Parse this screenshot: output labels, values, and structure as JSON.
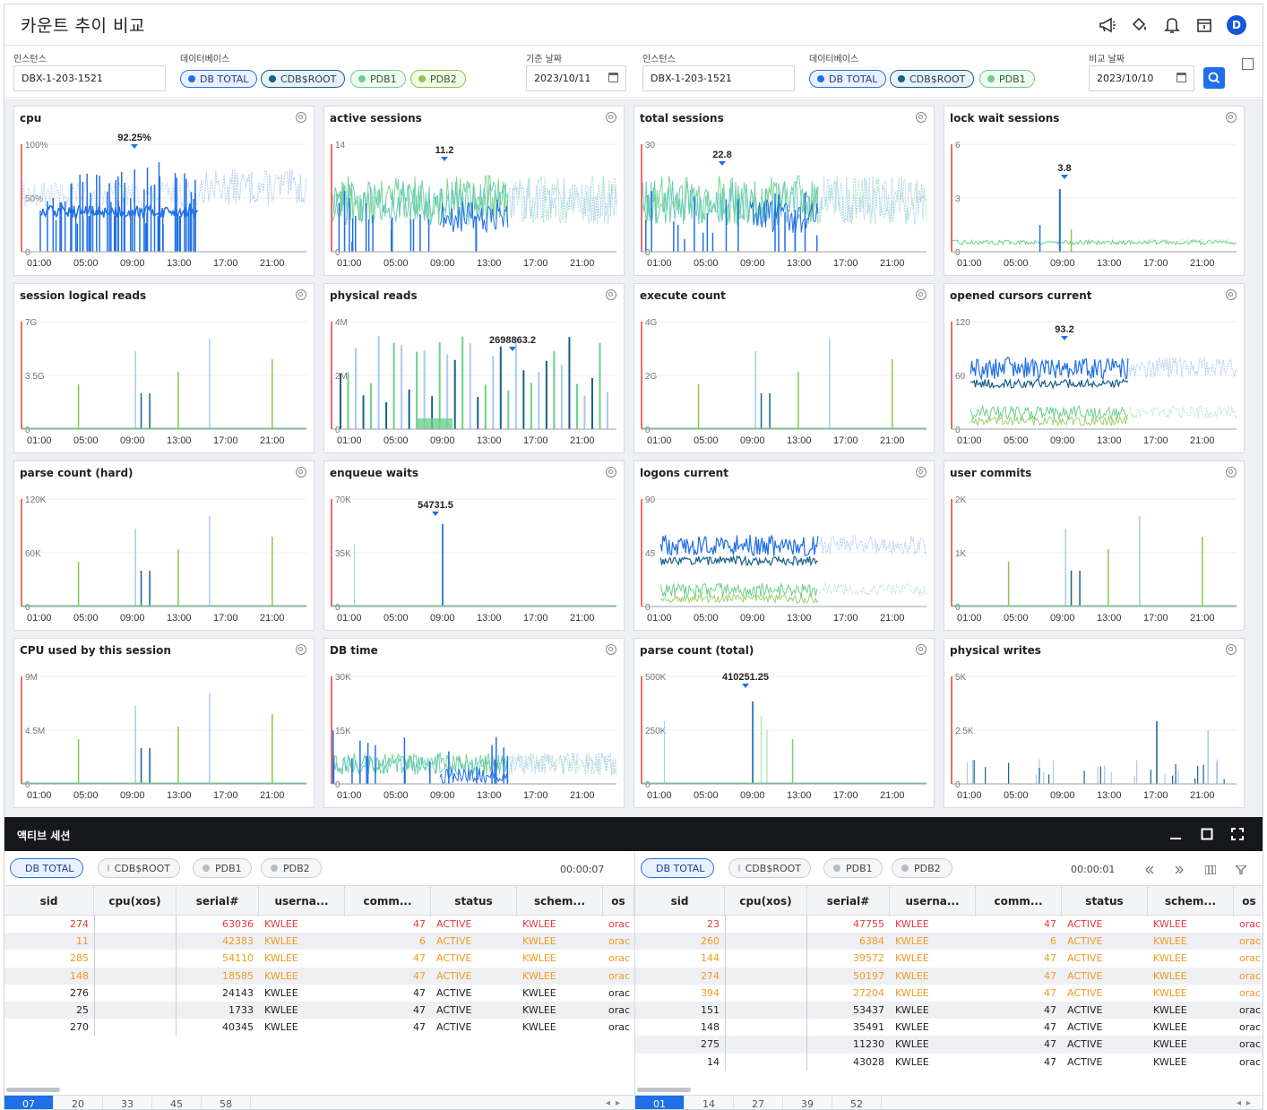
{
  "app": {
    "title": "카운트 추이 비교"
  },
  "header_icons": [
    "megaphone-icon",
    "paint-bucket-icon",
    "bell-icon",
    "calendar-icon"
  ],
  "user": {
    "initial": "D"
  },
  "filters": {
    "left": {
      "instance_label": "인스턴스",
      "instance_value": "DBX-1-203-1521",
      "db_label": "데이터베이스",
      "chips": [
        "DB TOTAL",
        "CDB$ROOT",
        "PDB1",
        "PDB2"
      ],
      "date_label": "기준 날짜",
      "date_value": "2023/10/11"
    },
    "right": {
      "instance_label": "인스턴스",
      "instance_value": "DBX-1-203-1521",
      "db_label": "데이터베이스",
      "chips": [
        "DB TOTAL",
        "CDB$ROOT",
        "PDB1"
      ],
      "date_label": "비교 날짜",
      "date_value": "2023/10/10"
    }
  },
  "colors": {
    "db_total": "#1f6fe8",
    "cdb_root": "#17608b",
    "pdb1": "#6dd08a",
    "pdb2": "#8ac64b",
    "compare_light": "#a9c9f2",
    "marker": "#f06b6b"
  },
  "x_ticks": [
    "01:00",
    "05:00",
    "09:00",
    "13:00",
    "17:00",
    "21:00"
  ],
  "charts": [
    {
      "title": "cpu",
      "yticks": [
        "100%",
        "50%",
        "0"
      ],
      "peak_label": "92.25%",
      "style": "cpu"
    },
    {
      "title": "active sessions",
      "yticks": [
        "14",
        "7",
        "0"
      ],
      "peak_label": "11.2",
      "style": "noisy"
    },
    {
      "title": "total sessions",
      "yticks": [
        "30",
        "15",
        "0"
      ],
      "peak_label": "22.8",
      "style": "noisy"
    },
    {
      "title": "lock wait sessions",
      "yticks": [
        "6",
        "3",
        "0"
      ],
      "peak_label": "3.8",
      "style": "flat"
    },
    {
      "title": "session logical reads",
      "yticks": [
        "7G",
        "3.5G",
        "0"
      ],
      "peak_label": "",
      "style": "spikes"
    },
    {
      "title": "physical reads",
      "yticks": [
        "4M",
        "2M",
        "0"
      ],
      "peak_label": "2698863.2",
      "style": "manyspikes"
    },
    {
      "title": "execute count",
      "yticks": [
        "4G",
        "2G",
        "0"
      ],
      "peak_label": "",
      "style": "spikes"
    },
    {
      "title": "opened cursors current",
      "yticks": [
        "120",
        "60",
        "0"
      ],
      "peak_label": "93.2",
      "style": "bands"
    },
    {
      "title": "parse count (hard)",
      "yticks": [
        "120K",
        "60K",
        "0"
      ],
      "peak_label": "",
      "style": "spikes"
    },
    {
      "title": "enqueue waits",
      "yticks": [
        "70K",
        "35K",
        "0"
      ],
      "peak_label": "54731.5",
      "style": "single"
    },
    {
      "title": "logons current",
      "yticks": [
        "90",
        "45",
        "0"
      ],
      "peak_label": "",
      "style": "bands"
    },
    {
      "title": "user commits",
      "yticks": [
        "2K",
        "1K",
        "0"
      ],
      "peak_label": "",
      "style": "spikes"
    },
    {
      "title": "CPU used by this session",
      "yticks": [
        "9M",
        "4.5M",
        "0"
      ],
      "peak_label": "",
      "style": "spikes"
    },
    {
      "title": "DB time",
      "yticks": [
        "30K",
        "15K",
        "0"
      ],
      "peak_label": "",
      "style": "noisylow"
    },
    {
      "title": "parse count (total)",
      "yticks": [
        "500K",
        "250K",
        "0"
      ],
      "peak_label": "410251.25",
      "style": "single"
    },
    {
      "title": "physical writes",
      "yticks": [
        "5K",
        "2.5K",
        "0"
      ],
      "peak_label": "",
      "style": "lowspikes"
    }
  ],
  "bottom": {
    "title": "액티브 세션",
    "left": {
      "chips": [
        "DB TOTAL",
        "CDB$ROOT",
        "PDB1",
        "PDB2"
      ],
      "timer": "00:00:07",
      "columns": [
        "sid",
        "cpu(xos)",
        "serial#",
        "userna...",
        "comm...",
        "status",
        "schem...",
        "os"
      ],
      "rows": [
        {
          "sid": "274",
          "cpu": "",
          "serial": "63036",
          "user": "KWLEE",
          "comm": "47",
          "status": "ACTIVE",
          "schema": "KWLEE",
          "os": "orac",
          "level": "red"
        },
        {
          "sid": "11",
          "cpu": "",
          "serial": "42383",
          "user": "KWLEE",
          "comm": "6",
          "status": "ACTIVE",
          "schema": "KWLEE",
          "os": "orac",
          "level": "orange"
        },
        {
          "sid": "285",
          "cpu": "",
          "serial": "54110",
          "user": "KWLEE",
          "comm": "47",
          "status": "ACTIVE",
          "schema": "KWLEE",
          "os": "orac",
          "level": "orange"
        },
        {
          "sid": "148",
          "cpu": "",
          "serial": "18585",
          "user": "KWLEE",
          "comm": "47",
          "status": "ACTIVE",
          "schema": "KWLEE",
          "os": "orac",
          "level": "orange"
        },
        {
          "sid": "276",
          "cpu": "",
          "serial": "24143",
          "user": "KWLEE",
          "comm": "47",
          "status": "ACTIVE",
          "schema": "KWLEE",
          "os": "orac",
          "level": "normal"
        },
        {
          "sid": "25",
          "cpu": "",
          "serial": "1733",
          "user": "KWLEE",
          "comm": "47",
          "status": "ACTIVE",
          "schema": "KWLEE",
          "os": "orac",
          "level": "normal"
        },
        {
          "sid": "270",
          "cpu": "",
          "serial": "40345",
          "user": "KWLEE",
          "comm": "47",
          "status": "ACTIVE",
          "schema": "KWLEE",
          "os": "orac",
          "level": "normal"
        }
      ],
      "pages": [
        "07",
        "20",
        "33",
        "45",
        "58"
      ]
    },
    "right": {
      "chips": [
        "DB TOTAL",
        "CDB$ROOT",
        "PDB1",
        "PDB2"
      ],
      "timer": "00:00:01",
      "columns": [
        "sid",
        "cpu(xos)",
        "serial#",
        "userna...",
        "comm...",
        "status",
        "schem...",
        "os"
      ],
      "rows": [
        {
          "sid": "23",
          "cpu": "",
          "serial": "47755",
          "user": "KWLEE",
          "comm": "47",
          "status": "ACTIVE",
          "schema": "KWLEE",
          "os": "orac",
          "level": "red"
        },
        {
          "sid": "260",
          "cpu": "",
          "serial": "6384",
          "user": "KWLEE",
          "comm": "6",
          "status": "ACTIVE",
          "schema": "KWLEE",
          "os": "orac",
          "level": "orange"
        },
        {
          "sid": "144",
          "cpu": "",
          "serial": "39572",
          "user": "KWLEE",
          "comm": "47",
          "status": "ACTIVE",
          "schema": "KWLEE",
          "os": "orac",
          "level": "orange"
        },
        {
          "sid": "274",
          "cpu": "",
          "serial": "50197",
          "user": "KWLEE",
          "comm": "47",
          "status": "ACTIVE",
          "schema": "KWLEE",
          "os": "orac",
          "level": "orange"
        },
        {
          "sid": "394",
          "cpu": "",
          "serial": "27204",
          "user": "KWLEE",
          "comm": "47",
          "status": "ACTIVE",
          "schema": "KWLEE",
          "os": "orac",
          "level": "orange"
        },
        {
          "sid": "151",
          "cpu": "",
          "serial": "53437",
          "user": "KWLEE",
          "comm": "47",
          "status": "ACTIVE",
          "schema": "KWLEE",
          "os": "orac",
          "level": "normal"
        },
        {
          "sid": "148",
          "cpu": "",
          "serial": "35491",
          "user": "KWLEE",
          "comm": "47",
          "status": "ACTIVE",
          "schema": "KWLEE",
          "os": "orac",
          "level": "normal"
        },
        {
          "sid": "275",
          "cpu": "",
          "serial": "11230",
          "user": "KWLEE",
          "comm": "47",
          "status": "ACTIVE",
          "schema": "KWLEE",
          "os": "orac",
          "level": "normal"
        },
        {
          "sid": "14",
          "cpu": "",
          "serial": "43028",
          "user": "KWLEE",
          "comm": "47",
          "status": "ACTIVE",
          "schema": "KWLEE",
          "os": "orac",
          "level": "normal"
        }
      ],
      "pages": [
        "01",
        "14",
        "27",
        "39",
        "52"
      ]
    }
  }
}
